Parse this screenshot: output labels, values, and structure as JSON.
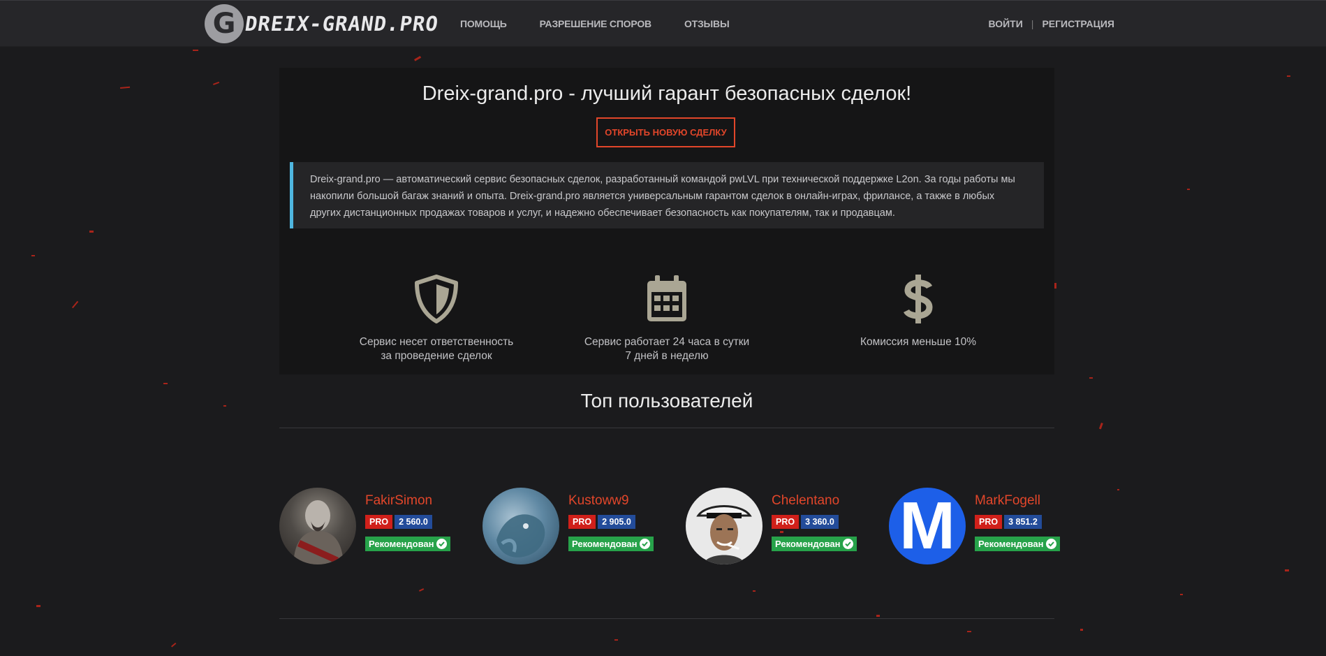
{
  "header": {
    "logo_mark": "G",
    "logo_text": "DREIX-GRAND.PRO",
    "nav": [
      "ПОМОЩЬ",
      "РАЗРЕШЕНИЕ СПОРОВ",
      "ОТЗЫВЫ"
    ],
    "login": "ВОЙТИ",
    "separator": "|",
    "register": "РЕГИСТРАЦИЯ"
  },
  "hero": {
    "title": "Dreix-grand.pro - лучший гарант безопасных сделок!",
    "cta": "ОТКРЫТЬ НОВУЮ СДЕЛКУ",
    "description": "Dreix-grand.pro — автоматический сервис безопасных сделок, разработанный командой pwLVL при технической поддержке L2on. За годы работы мы накопили большой багаж знаний и опыта. Dreix-grand.pro является универсальным гарантом сделок в онлайн-играх, фрилансе, а также в любых других дистанционных продажах товаров и услуг, и надежно обеспечивает безопасность как покупателям, так и продавцам."
  },
  "features": [
    {
      "icon": "shield-icon",
      "line1": "Сервис несет ответственность",
      "line2": "за проведение сделок"
    },
    {
      "icon": "calendar-icon",
      "line1": "Сервис работает 24 часа в сутки",
      "line2": "7 дней в неделю"
    },
    {
      "icon": "dollar-icon",
      "line1": "Комиссия меньше 10%",
      "line2": ""
    }
  ],
  "top_users": {
    "title": "Топ пользователей",
    "users": [
      {
        "name": "FakirSimon",
        "badge": "PRO",
        "score": "2 560.0",
        "status": "Рекомендован"
      },
      {
        "name": "Kustoww9",
        "badge": "PRO",
        "score": "2 905.0",
        "status": "Рекомендован"
      },
      {
        "name": "Chelentano",
        "badge": "PRO",
        "score": "3 360.0",
        "status": "Рекомендован"
      },
      {
        "name": "MarkFogell",
        "badge": "PRO",
        "score": "3 851.2",
        "status": "Рекомендован",
        "avatar_letter": "M"
      }
    ]
  },
  "colors": {
    "accent": "#e2462a",
    "pro": "#d0201a",
    "score": "#234c9a",
    "recommended": "#27a24a",
    "quote_border": "#4fb6df"
  }
}
